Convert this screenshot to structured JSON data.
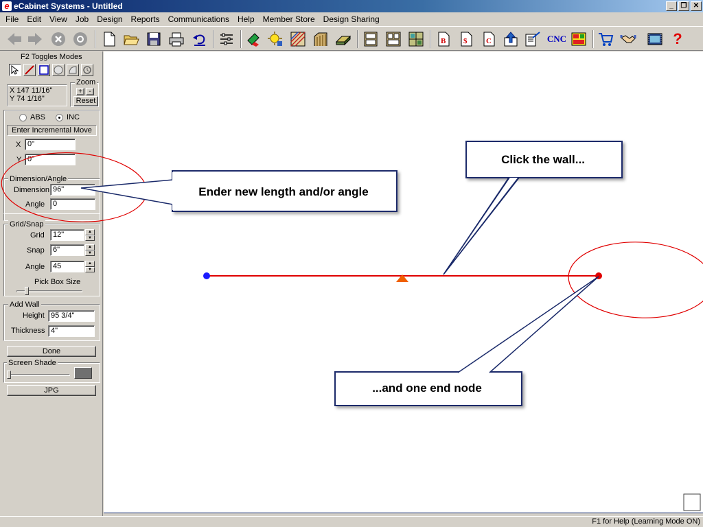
{
  "window": {
    "title": "eCabinet Systems - Untitled",
    "app_icon": "e",
    "minimize": "_",
    "restore": "❐",
    "close": "✕"
  },
  "menu": [
    "File",
    "Edit",
    "View",
    "Job",
    "Design",
    "Reports",
    "Communications",
    "Help",
    "Member Store",
    "Design Sharing"
  ],
  "toolbar": {
    "cnc_label": "CNC",
    "report_b": "B",
    "report_dollar": "$",
    "report_c": "C",
    "help_glyph": "?",
    "icons": [
      "back-arrow-icon",
      "forward-arrow-icon",
      "stop-icon",
      "refresh-icon",
      "new-file-icon",
      "open-folder-icon",
      "save-icon",
      "print-icon",
      "undo-icon",
      "settings-list-icon",
      "material-icon",
      "light-icon",
      "texture-icon",
      "door-icon",
      "hardware-icon",
      "cabinet-icon",
      "cabinet-list-icon",
      "room-layout-icon",
      "bid-report-icon",
      "cost-report-icon",
      "cut-list-icon",
      "upload-icon",
      "export-icon",
      "cnc-icon",
      "optimizer-icon",
      "store-cart-icon",
      "handshake-icon",
      "film-icon",
      "help-icon"
    ]
  },
  "panel": {
    "modes_label": "F2 Toggles Modes",
    "coord_x": "X 147 11/16\"",
    "coord_y": "Y 74 1/16\"",
    "zoom_label": "Zoom",
    "zoom_in": "+",
    "zoom_out": "-",
    "zoom_reset": "Reset",
    "abs_label": "ABS",
    "inc_label": "INC",
    "incremental_mode": "INC",
    "enter_move_label": "Enter Incremental Move",
    "x_label": "X",
    "x_value": "0\"",
    "y_label": "Y",
    "y_value": "0\"",
    "dimension_group": "Dimension/Angle",
    "dimension_label": "Dimension",
    "dimension_value": "96\"",
    "angle_label": "Angle",
    "angle_value": "0",
    "grid_group": "Grid/Snap",
    "grid_label": "Grid",
    "grid_value": "12\"",
    "snap_label": "Snap",
    "snap_value": "6\"",
    "snap_angle_label": "Angle",
    "snap_angle_value": "45",
    "pickbox_label": "Pick Box Size",
    "addwall_group": "Add Wall",
    "height_label": "Height",
    "height_value": "95 3/4\"",
    "thickness_label": "Thickness",
    "thickness_value": "4\"",
    "done_label": "Done",
    "screen_shade_label": "Screen Shade",
    "jpg_label": "JPG"
  },
  "callouts": {
    "dimension": "Ender new length and/or angle",
    "wall": "Click the wall...",
    "node": "...and one end node"
  },
  "colors": {
    "wall": "#e00000",
    "start_node": "#1a1aff",
    "end_node": "#e00000",
    "marker": "#f06000",
    "callout_border": "#1a2a6a",
    "ellipse": "#e00000"
  },
  "status": {
    "help_text": "F1 for Help (Learning Mode ON)"
  }
}
